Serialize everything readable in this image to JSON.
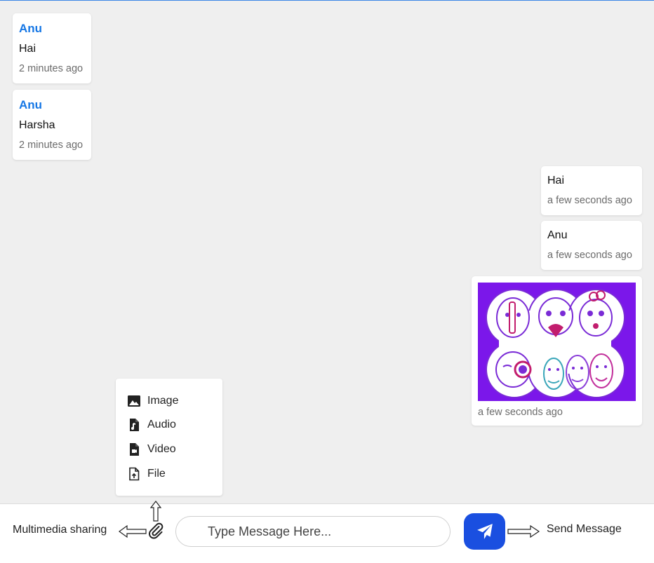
{
  "received_messages": [
    {
      "sender": "Anu",
      "text": "Hai",
      "time": "2 minutes ago"
    },
    {
      "sender": "Anu",
      "text": "Harsha",
      "time": "2 minutes ago"
    }
  ],
  "sent_messages": [
    {
      "text": "Hai",
      "time": "a few seconds ago"
    },
    {
      "text": "Anu",
      "time": "a few seconds ago"
    }
  ],
  "image_message": {
    "image": "emoji-faces-illustration",
    "time": "a few seconds ago",
    "background": "#7b17ea"
  },
  "attach_menu": {
    "items": [
      {
        "label": "Image",
        "icon": "image-icon"
      },
      {
        "label": "Audio",
        "icon": "audio-file-icon"
      },
      {
        "label": "Video",
        "icon": "video-file-icon"
      },
      {
        "label": "File",
        "icon": "upload-file-icon"
      }
    ]
  },
  "composer": {
    "placeholder": "Type Message Here...",
    "attach_icon": "paperclip-icon",
    "send_icon": "paper-plane-icon",
    "send_color": "#1a4fe0"
  },
  "annotations": {
    "multimedia": "Multimedia sharing",
    "send": "Send Message"
  },
  "colors": {
    "sender_name": "#1677e5",
    "background": "#efefef"
  }
}
